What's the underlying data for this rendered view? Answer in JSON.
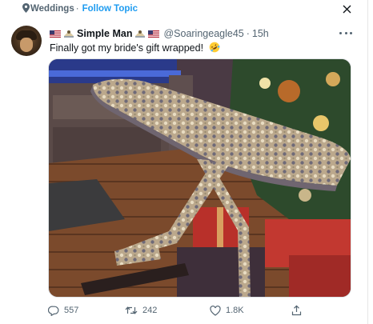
{
  "topic": {
    "name": "Weddings",
    "separator": "·",
    "follow_label": "Follow Topic"
  },
  "author": {
    "name": "Simple Man",
    "handle": "@Soaringeagle45",
    "time": "15h"
  },
  "tweet": {
    "text": "Finally got my bride's gift wrapped!",
    "emoji": "rolling-on-floor-laughing"
  },
  "media": {
    "description_icon": "photo"
  },
  "actions": {
    "replies": "557",
    "retweets": "242",
    "likes": "1.8K"
  },
  "colors": {
    "accent": "#1d9bf0",
    "secondary_text": "#536471",
    "text": "#0f1419"
  }
}
